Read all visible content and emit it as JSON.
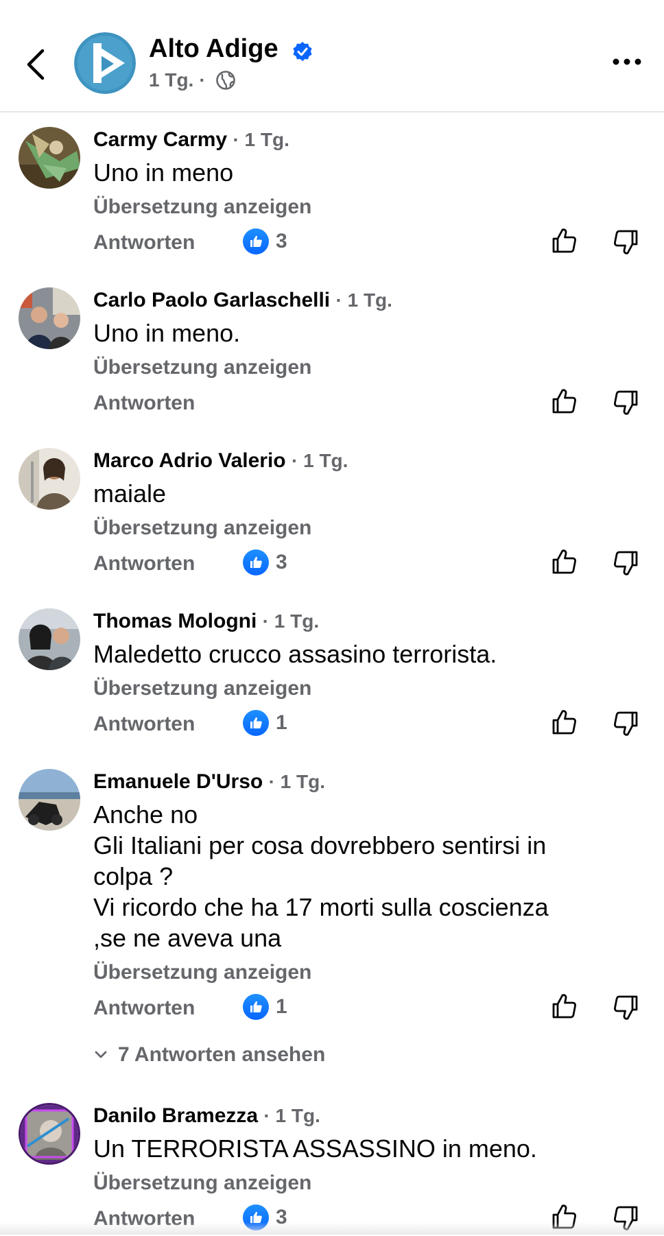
{
  "header": {
    "page_name": "Alto Adige",
    "time": "1 Tg.",
    "separator": "·",
    "icons": {
      "back": "chevron-left-icon",
      "verified": "verified-badge-icon",
      "audience": "globe-icon",
      "more": "more-horizontal-icon"
    },
    "accent_color": "#0866ff"
  },
  "comments": [
    {
      "author": "Carmy Carmy",
      "time": "· 1 Tg.",
      "lines": [
        "Uno in meno"
      ],
      "translate": "Übersetzung anzeigen",
      "reply": "Antworten",
      "likes": "3"
    },
    {
      "author": "Carlo Paolo Garlaschelli",
      "time": "· 1 Tg.",
      "lines": [
        "Uno in meno."
      ],
      "translate": "Übersetzung anzeigen",
      "reply": "Antworten",
      "likes": ""
    },
    {
      "author": "Marco Adrio Valerio",
      "time": "· 1 Tg.",
      "lines": [
        "maiale"
      ],
      "translate": "Übersetzung anzeigen",
      "reply": "Antworten",
      "likes": "3"
    },
    {
      "author": "Thomas Mologni",
      "time": "· 1 Tg.",
      "lines": [
        "Maledetto crucco assasino terrorista."
      ],
      "translate": "Übersetzung anzeigen",
      "reply": "Antworten",
      "likes": "1"
    },
    {
      "author": "Emanuele D'Urso",
      "time": "· 1 Tg.",
      "lines": [
        "Anche no",
        "Gli Italiani per cosa dovrebbero sentirsi in",
        "colpa ?",
        "Vi ricordo che ha 17 morti sulla coscienza",
        ",se ne aveva una"
      ],
      "translate": "Übersetzung anzeigen",
      "reply": "Antworten",
      "likes": "1",
      "view_replies": "7 Antworten ansehen"
    },
    {
      "author": "Danilo Bramezza",
      "time": "· 1 Tg.",
      "lines": [
        "Un TERRORISTA ASSASSINO in meno."
      ],
      "translate": "Übersetzung anzeigen",
      "reply": "Antworten",
      "likes": "3"
    }
  ]
}
